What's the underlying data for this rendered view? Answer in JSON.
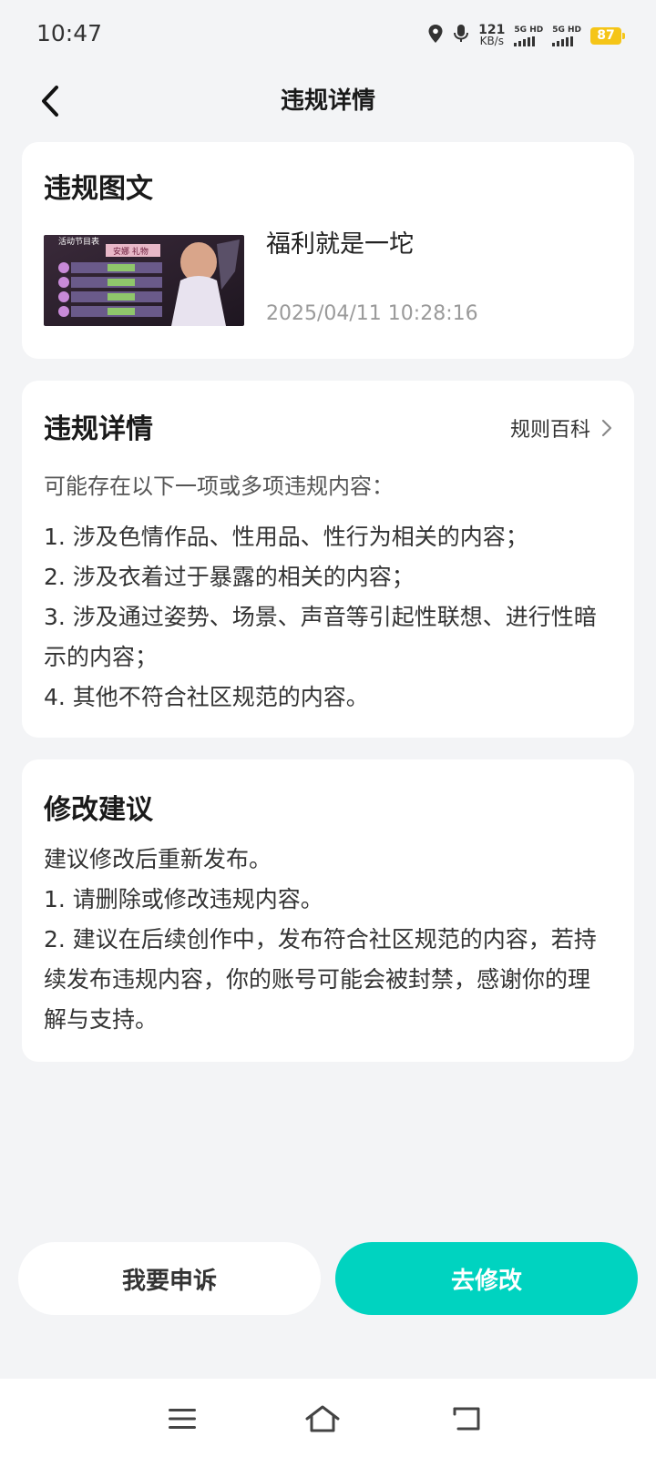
{
  "status_bar": {
    "time": "10:47",
    "net_speed_value": "121",
    "net_speed_unit": "KB/s",
    "sim1_label": "5G HD",
    "sim2_label": "5G HD",
    "battery": "87",
    "icons": [
      "location-icon",
      "microphone-icon",
      "signal-icon",
      "battery-icon"
    ]
  },
  "header": {
    "title": "违规详情",
    "back_icon": "chevron-left-icon"
  },
  "post_card": {
    "title": "违规图文",
    "post_title": "福利就是一坨",
    "post_time": "2025/04/11 10:28:16",
    "thumbnail_text": {
      "event": "活动节目表",
      "banner": "安娜  礼物"
    }
  },
  "detail_card": {
    "title": "违规详情",
    "rule_link": "规则百科",
    "intro": "可能存在以下一项或多项违规内容：",
    "items": [
      "1. 涉及色情作品、性用品、性行为相关的内容；",
      "2. 涉及衣着过于暴露的相关的内容；",
      "3. 涉及通过姿势、场景、声音等引起性联想、进行性暗示的内容；",
      "4. 其他不符合社区规范的内容。"
    ]
  },
  "suggest_card": {
    "title": "修改建议",
    "lines": [
      "建议修改后重新发布。",
      "1. 请删除或修改违规内容。",
      "2. 建议在后续创作中，发布符合社区规范的内容，若持续发布违规内容，你的账号可能会被封禁，感谢你的理解与支持。"
    ]
  },
  "actions": {
    "appeal": "我要申诉",
    "modify": "去修改"
  },
  "colors": {
    "accent": "#00d3c0",
    "background": "#f3f4f6",
    "battery": "#f5c518"
  }
}
